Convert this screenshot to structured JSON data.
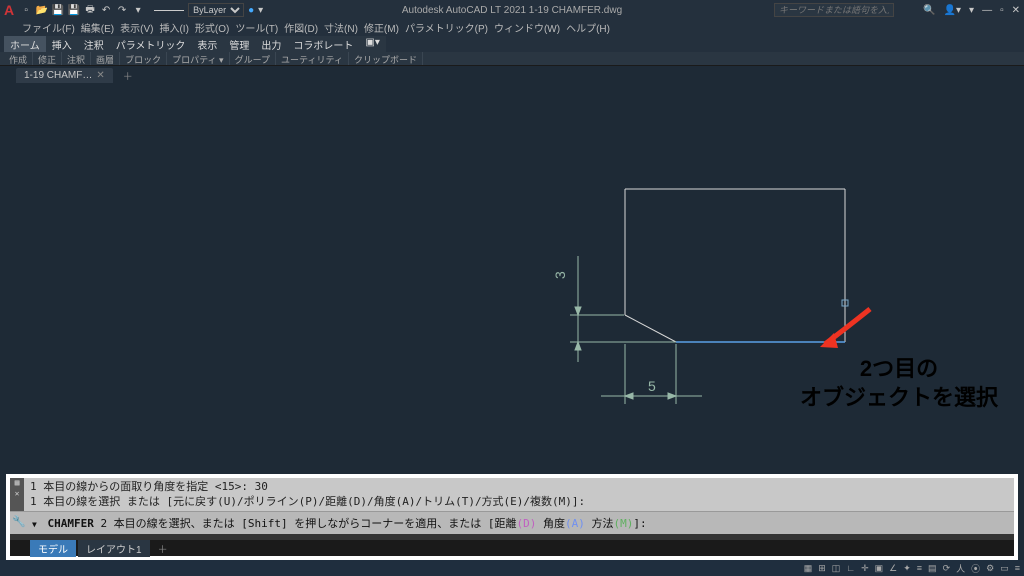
{
  "app": {
    "title": "Autodesk AutoCAD LT 2021   1-19 CHAMFER.dwg",
    "search_placeholder": "キーワードまたは語句を入力"
  },
  "qat": {
    "layer_name": "ByLayer"
  },
  "menus": [
    "ファイル(F)",
    "編集(E)",
    "表示(V)",
    "挿入(I)",
    "形式(O)",
    "ツール(T)",
    "作図(D)",
    "寸法(N)",
    "修正(M)",
    "パラメトリック(P)",
    "ウィンドウ(W)",
    "ヘルプ(H)"
  ],
  "ribbon_tabs": [
    "ホーム",
    "挿入",
    "注釈",
    "パラメトリック",
    "表示",
    "管理",
    "出力",
    "コラボレート"
  ],
  "ribbon_panels": [
    "作成",
    "修正",
    "注釈",
    "画層",
    "ブロック",
    "プロパティ ▾",
    "グループ",
    "ユーティリティ",
    "クリップボード"
  ],
  "file_tab": "1-19 CHAMF…",
  "drawing": {
    "dim5": "5",
    "dim3": "3"
  },
  "annotation": {
    "line1": "2つ目の",
    "line2": "オブジェクトを選択"
  },
  "command": {
    "hist_line1": "1 本目の線からの面取り角度を指定 <15>: 30",
    "hist_line2": "1 本目の線を選択 または [元に戻す(U)/ポリライン(P)/距離(D)/角度(A)/トリム(T)/方式(E)/複数(M)]:",
    "input_cmd": "CHAMFER",
    "input_text1": "2 本目の線を選択、または [Shift] を押しながらコーナーを適用、または [",
    "opt_d_label": "距離",
    "opt_d_key": "(D)",
    "opt_a_label": " 角度",
    "opt_a_key": "(A)",
    "opt_m_label": " 方法",
    "opt_m_key": "(M)",
    "input_text2": "]:"
  },
  "model_tabs": {
    "model": "モデル",
    "layout1": "レイアウト1"
  }
}
